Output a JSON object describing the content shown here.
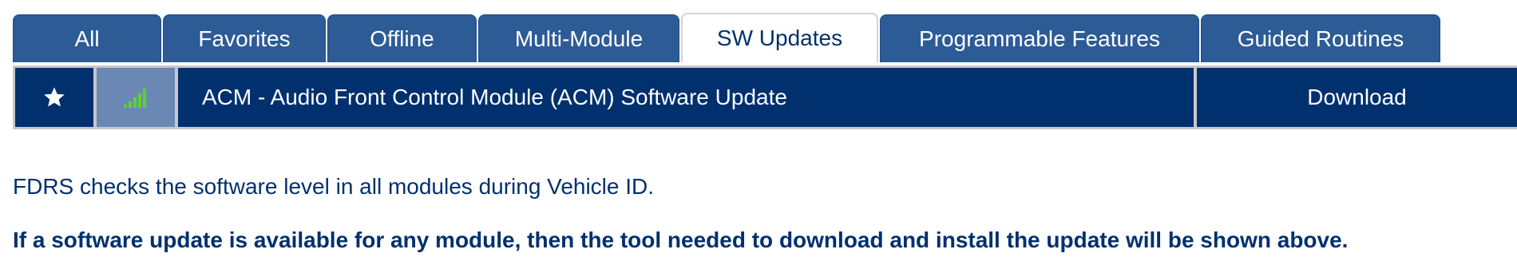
{
  "tabs": [
    {
      "label": "All"
    },
    {
      "label": "Favorites"
    },
    {
      "label": "Offline"
    },
    {
      "label": "Multi-Module"
    },
    {
      "label": "SW Updates",
      "active": true
    },
    {
      "label": "Programmable Features"
    },
    {
      "label": "Guided Routines"
    }
  ],
  "update_row": {
    "favorite_icon": "star-icon",
    "signal_icon": "signal-strength-icon",
    "signal_color": "#5fd12e",
    "title": "ACM - Audio Front Control Module (ACM) Software Update",
    "action_label": "Download"
  },
  "messages": {
    "info": "FDRS checks the software level in all modules during Vehicle ID.",
    "note": "If a software update is available for any module, then the tool needed to download and install the update will be shown above."
  },
  "colors": {
    "primary": "#00306e",
    "tab": "#2c5b96",
    "signal_cell": "#6a88b3"
  }
}
